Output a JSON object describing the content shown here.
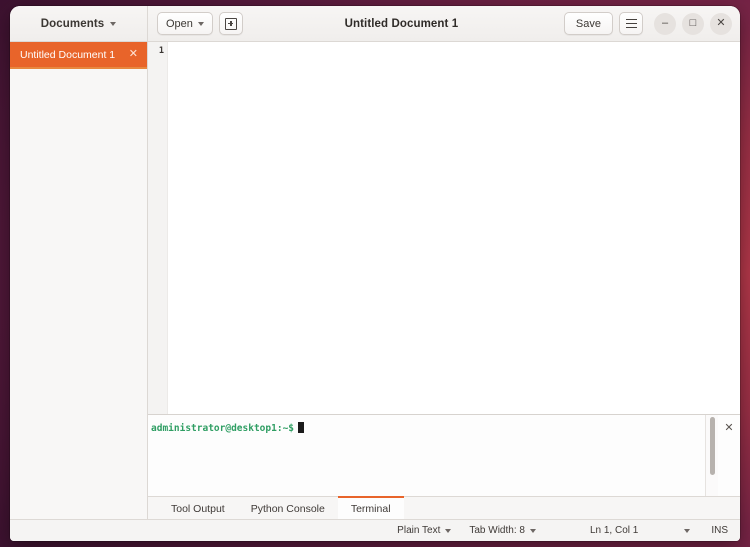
{
  "window": {
    "title": "Untitled Document 1",
    "accent_color": "#e8642a",
    "desktop_color": "#7a2547"
  },
  "headerbar": {
    "documents_label": "Documents",
    "documents_chevron": "chevron-down-icon",
    "open_label": "Open",
    "open_chevron": "chevron-down-icon",
    "new_document_icon": "new-document-icon",
    "save_label": "Save",
    "menu_icon": "hamburger-menu-icon",
    "minimize_glyph": "–",
    "maximize_glyph": "□",
    "close_glyph": "✕"
  },
  "sidebar": {
    "documents": [
      {
        "name": "Untitled Document 1",
        "close_glyph": "✕",
        "active": true
      }
    ]
  },
  "editor": {
    "line_numbers": [
      "1"
    ],
    "content": ""
  },
  "terminal": {
    "prompt_user_host": "administrator@desktop1",
    "prompt_path": ":~$",
    "command": "",
    "close_glyph": "✕"
  },
  "panel_tabs": [
    {
      "label": "Tool Output",
      "active": false
    },
    {
      "label": "Python Console",
      "active": false
    },
    {
      "label": "Terminal",
      "active": true
    }
  ],
  "statusbar": {
    "language": "Plain Text",
    "tab_width": "Tab Width: 8",
    "position": "Ln 1, Col 1",
    "insert_mode": "INS"
  }
}
